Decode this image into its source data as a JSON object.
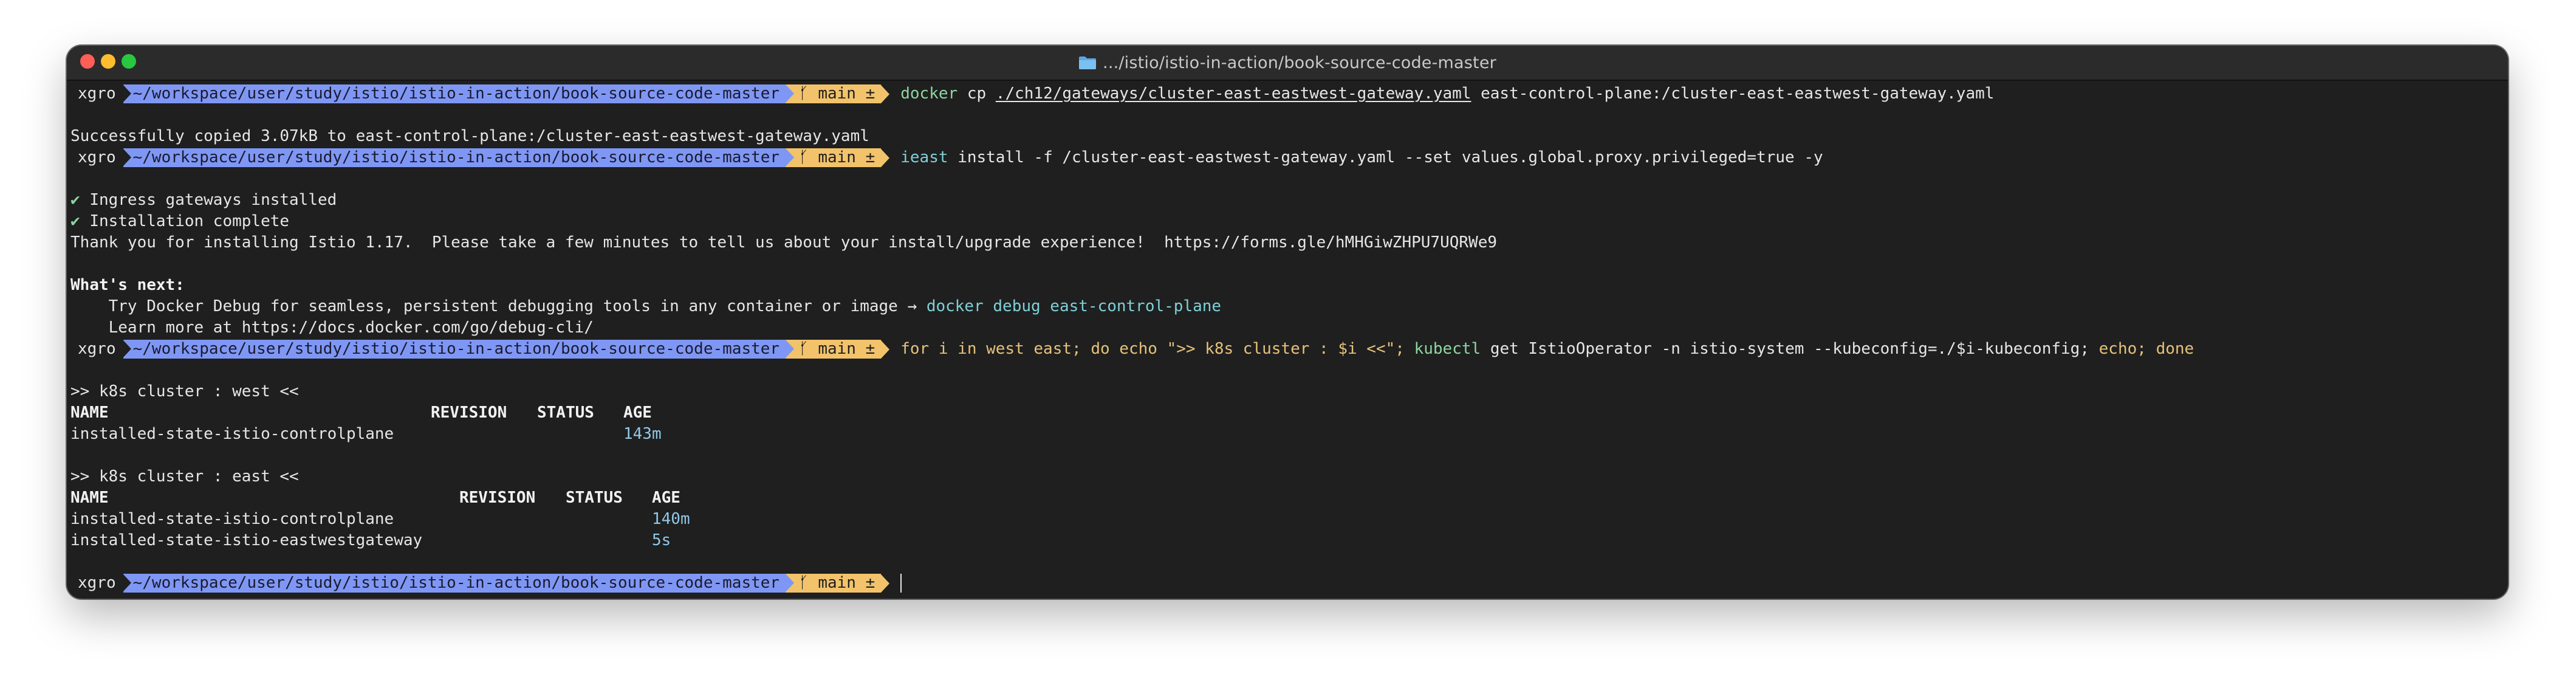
{
  "window": {
    "title": ".../istio/istio-in-action/book-source-code-master"
  },
  "prompt": {
    "user": "xgro",
    "path": "~/workspace/user/study/istio/istio-in-action/book-source-code-master",
    "branch_icon": "git-branch-icon",
    "branch": "main ±"
  },
  "lines": {
    "cmd1": {
      "program": "docker",
      "sub": "cp",
      "src": "./ch12/gateways/cluster-east-eastwest-gateway.yaml",
      "dest": "east-control-plane:/cluster-east-eastwest-gateway.yaml"
    },
    "out1": "Successfully copied 3.07kB to east-control-plane:/cluster-east-eastwest-gateway.yaml",
    "cmd2": {
      "program": "ieast",
      "args": "install -f /cluster-east-eastwest-gateway.yaml --set values.global.proxy.privileged=true -y"
    },
    "out2": {
      "check_mark": "✔",
      "ingress": "Ingress gateways installed",
      "complete": "Installation complete",
      "thanks": "Thank you for installing Istio 1.17.  Please take a few minutes to tell us about your install/upgrade experience!  https://forms.gle/hMHGiwZHPU7UQRWe9"
    },
    "whats_next": {
      "heading": "What's next:",
      "try_prefix": "    Try Docker Debug for seamless, persistent debugging tools in any container or image →",
      "try_cmd": "docker debug east-control-plane",
      "learn": "    Learn more at https://docs.docker.com/go/debug-cli/"
    },
    "cmd3": {
      "p1": "for i in west east;",
      "p2": "do",
      "p3": "echo",
      "p4": "\">> k8s cluster : $i <<\";",
      "p5": "kubectl",
      "p6": "get IstioOperator -n istio-system --kubeconfig=./$i-kubeconfig;",
      "p7": "echo;",
      "p8": "done"
    },
    "west": {
      "header": ">> k8s cluster : west <<",
      "columns": [
        "NAME",
        "REVISION",
        "STATUS",
        "AGE"
      ],
      "rows": [
        {
          "name": "installed-state-istio-controlplane",
          "revision": "",
          "status": "",
          "age": "143m"
        }
      ]
    },
    "east": {
      "header": ">> k8s cluster : east <<",
      "columns": [
        "NAME",
        "REVISION",
        "STATUS",
        "AGE"
      ],
      "rows": [
        {
          "name": "installed-state-istio-controlplane",
          "revision": "",
          "status": "",
          "age": "140m"
        },
        {
          "name": "installed-state-istio-eastwestgateway",
          "revision": "",
          "status": "",
          "age": "5s"
        }
      ]
    }
  },
  "colors": {
    "path_segment": "#7f97f4",
    "git_segment": "#f2c36b",
    "background": "#1f1f1f"
  }
}
